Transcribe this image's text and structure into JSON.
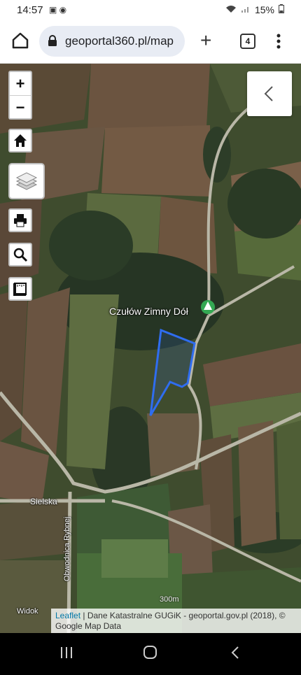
{
  "status_bar": {
    "time": "14:57",
    "battery": "15%"
  },
  "browser": {
    "url": "geoportal360.pl/map",
    "tab_count": "4"
  },
  "map": {
    "place_label": "Czułów Zimny Dół",
    "road_labels": {
      "sielska": "Sielska",
      "obwodnica": "Obwodnica Rybnej",
      "widok": "Widok"
    },
    "scale_label": "300m",
    "attribution": {
      "leaflet": "Leaflet",
      "text": " | Dane Katastralne GUGiK - geoportal.gov.pl (2018), © Google Map Data"
    },
    "parcel_outline_color": "#2f6df0"
  }
}
